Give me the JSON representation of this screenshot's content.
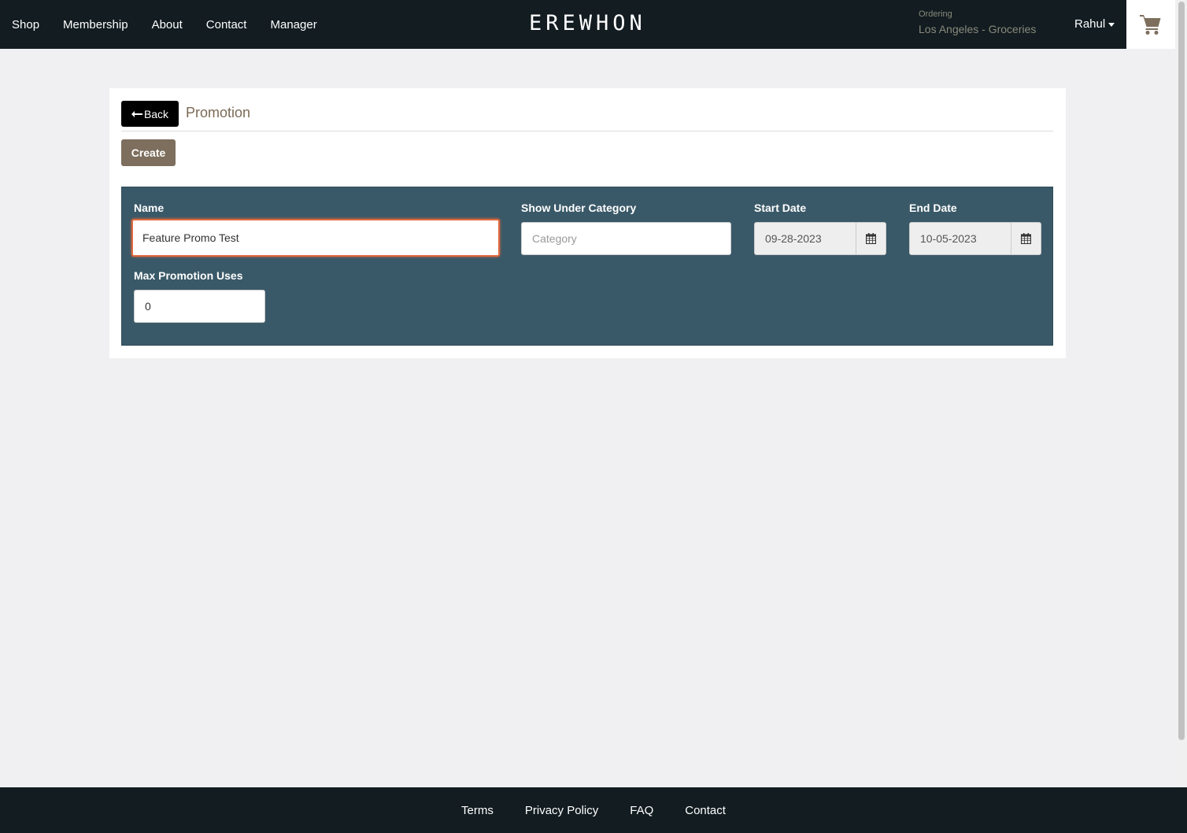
{
  "nav": {
    "links": [
      "Shop",
      "Membership",
      "About",
      "Contact",
      "Manager"
    ],
    "logo": "EREWHON",
    "ordering_label": "Ordering",
    "location": "Los Angeles - Groceries",
    "user": "Rahul"
  },
  "panel": {
    "back_label": "Back",
    "title": "Promotion",
    "create_label": "Create"
  },
  "form": {
    "name_label": "Name",
    "name_value": "Feature Promo Test",
    "category_label": "Show Under Category",
    "category_placeholder": "Category",
    "start_label": "Start Date",
    "start_value": "09-28-2023",
    "end_label": "End Date",
    "end_value": "10-05-2023",
    "max_uses_label": "Max Promotion Uses",
    "max_uses_value": "0"
  },
  "footer": {
    "links": [
      "Terms",
      "Privacy Policy",
      "FAQ",
      "Contact"
    ]
  },
  "colors": {
    "nav_bg": "#121c21",
    "form_bg": "#3a5968",
    "accent_brown": "#7d6e5d",
    "focus_border": "#e0693f"
  }
}
